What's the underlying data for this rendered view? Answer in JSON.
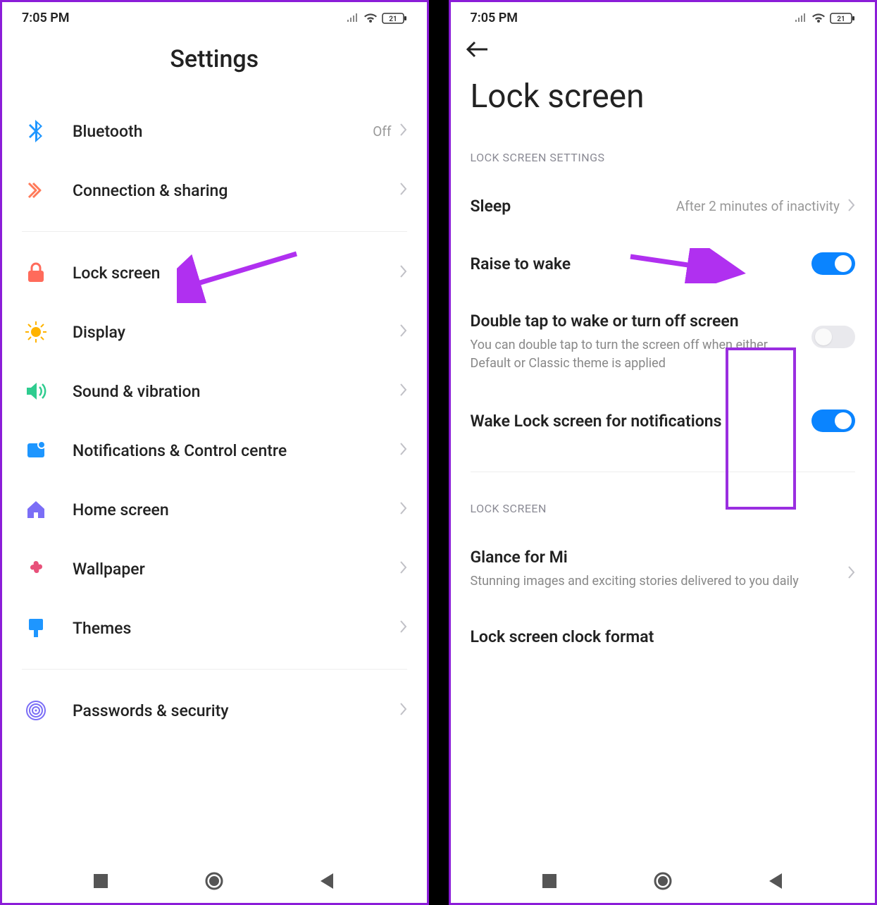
{
  "status": {
    "time": "7:05 PM",
    "battery": "21"
  },
  "left": {
    "title": "Settings",
    "items": [
      {
        "label": "Bluetooth",
        "value": "Off"
      },
      {
        "label": "Connection & sharing"
      },
      {
        "label": "Lock screen"
      },
      {
        "label": "Display"
      },
      {
        "label": "Sound & vibration"
      },
      {
        "label": "Notifications & Control centre"
      },
      {
        "label": "Home screen"
      },
      {
        "label": "Wallpaper"
      },
      {
        "label": "Themes"
      },
      {
        "label": "Passwords & security"
      }
    ]
  },
  "right": {
    "title": "Lock screen",
    "section1": "LOCK SCREEN SETTINGS",
    "sleep": {
      "label": "Sleep",
      "value": "After 2 minutes of inactivity"
    },
    "raise": {
      "label": "Raise to wake",
      "on": true
    },
    "doubletap": {
      "label": "Double tap to wake or turn off screen",
      "sub": "You can double tap to turn the screen off when either Default or Classic theme is applied",
      "on": false
    },
    "wake_notif": {
      "label": "Wake Lock screen for notifications",
      "on": true
    },
    "section2": "LOCK SCREEN",
    "glance": {
      "label": "Glance for Mi",
      "sub": "Stunning images and exciting stories delivered to you daily"
    },
    "clockfmt": {
      "label": "Lock screen clock format"
    }
  }
}
